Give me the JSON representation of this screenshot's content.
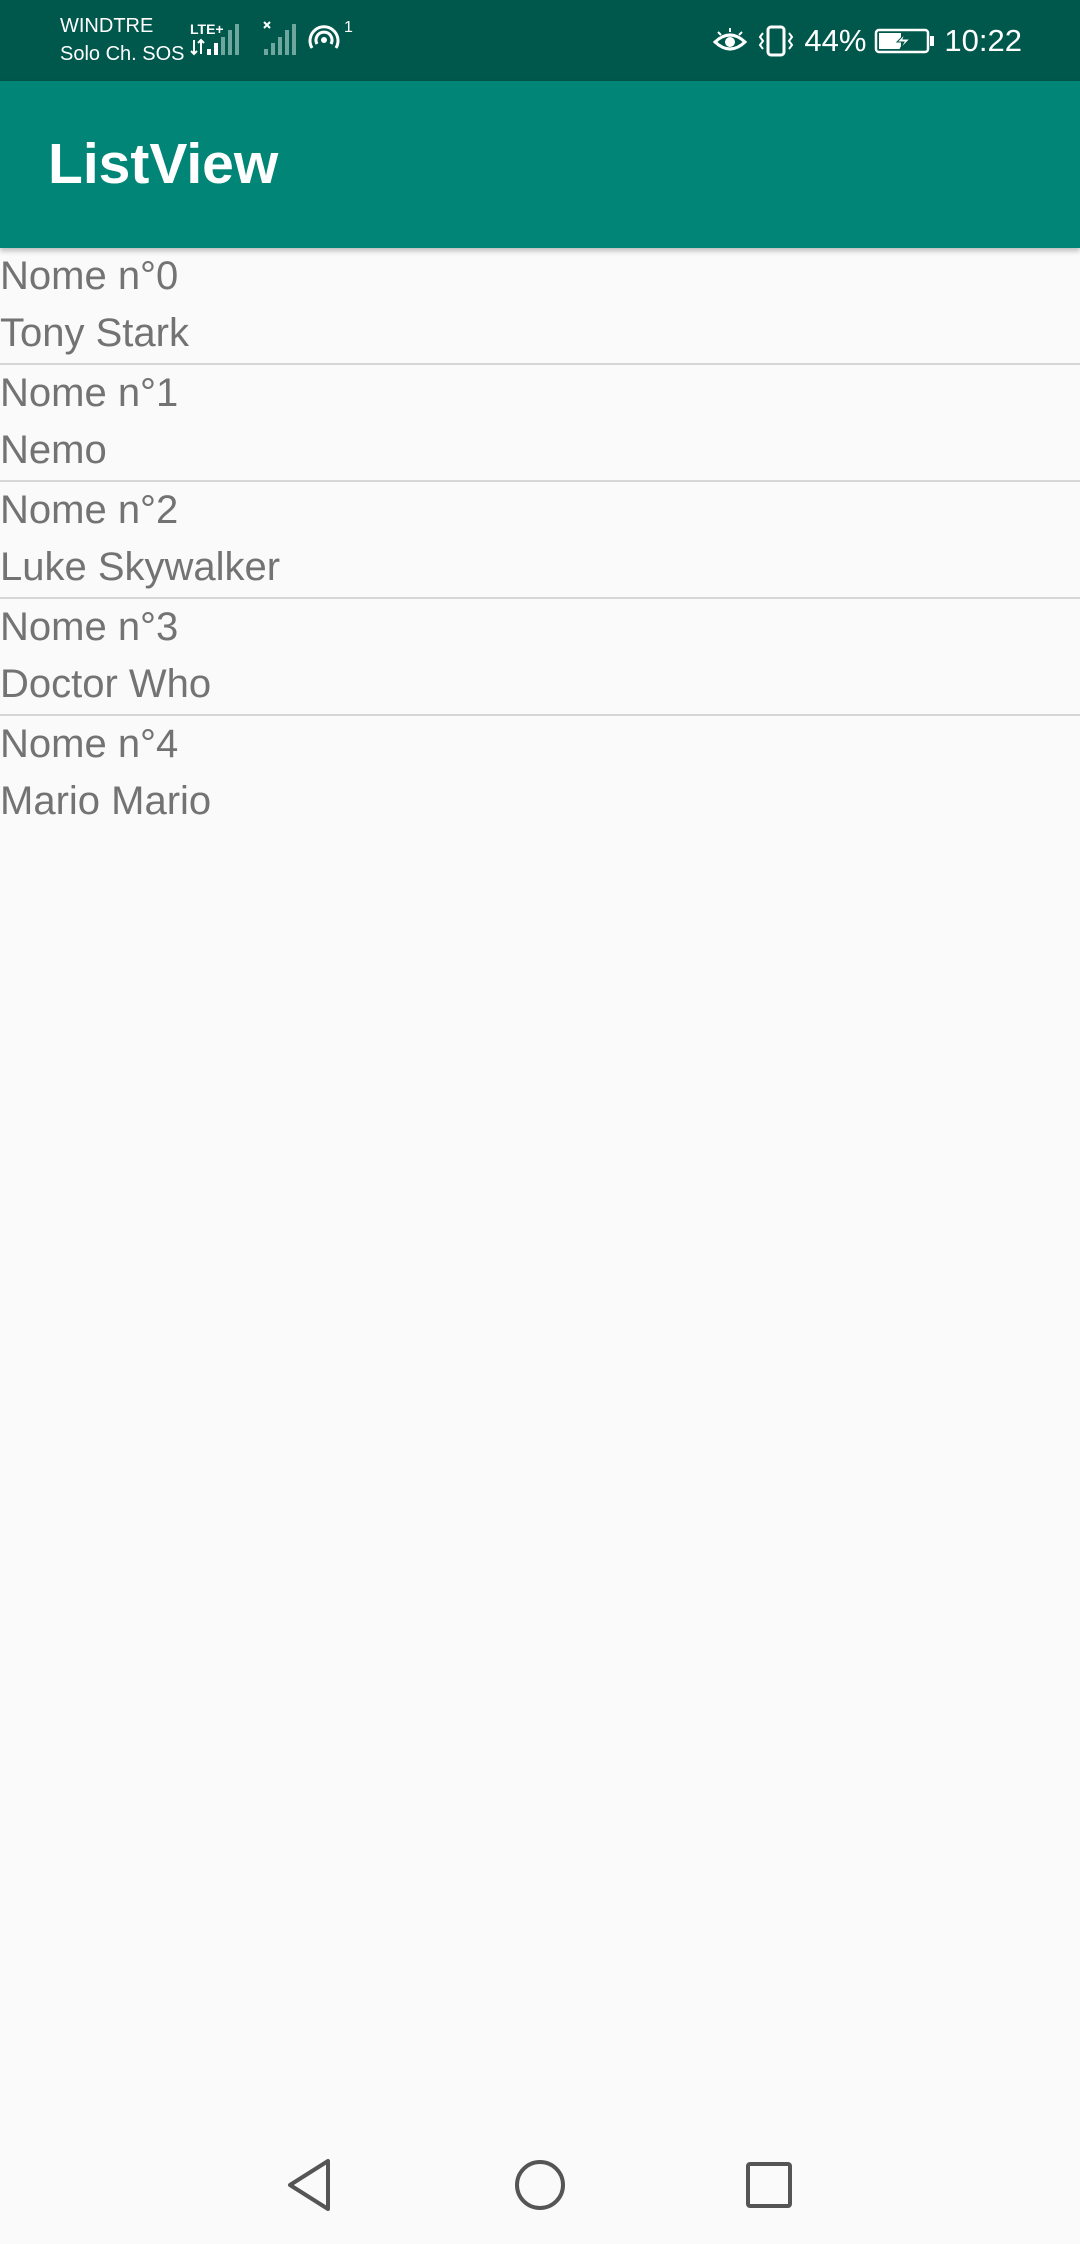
{
  "status_bar": {
    "carrier_line1": "WINDTRE",
    "carrier_line2": "Solo Ch. SOS",
    "network_type": "LTE+",
    "hotspot_count": "1",
    "battery_percent": "44%",
    "time": "10:22",
    "icons": [
      "signal-icon",
      "no-signal-icon",
      "hotspot-icon",
      "eye-comfort-icon",
      "vibrate-icon",
      "battery-charging-icon"
    ]
  },
  "app_bar": {
    "title": "ListView",
    "color": "#008577"
  },
  "list": {
    "items": [
      {
        "title": "Nome n°0",
        "subtitle": "Tony Stark"
      },
      {
        "title": "Nome n°1",
        "subtitle": "Nemo"
      },
      {
        "title": "Nome n°2",
        "subtitle": "Luke Skywalker"
      },
      {
        "title": "Nome n°3",
        "subtitle": "Doctor Who"
      },
      {
        "title": "Nome n°4",
        "subtitle": "Mario Mario"
      }
    ]
  },
  "nav_bar": {
    "buttons": [
      "back-icon",
      "home-icon",
      "recents-icon"
    ]
  },
  "colors": {
    "status_bar": "#00574b",
    "app_bar": "#008577",
    "background": "#fafafa",
    "list_text": "#737373",
    "divider": "#d6d6d6"
  }
}
